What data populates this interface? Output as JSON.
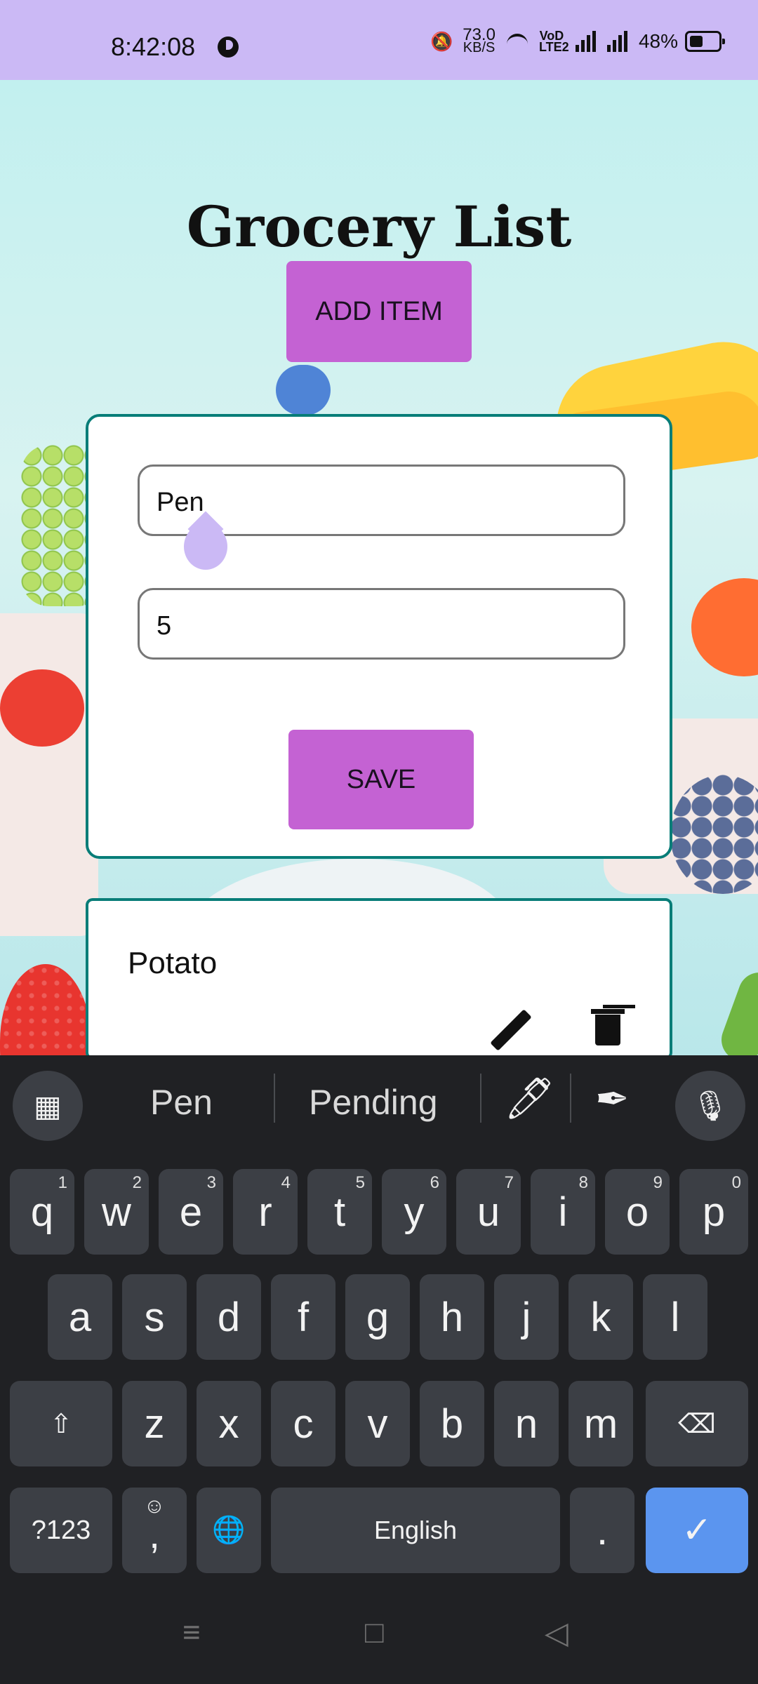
{
  "status": {
    "time": "8:42:08",
    "network_speed": "73.0",
    "network_unit": "KB/S",
    "network_type": "VoD LTE2",
    "battery": "48%"
  },
  "app": {
    "title": "Grocery List",
    "add_button": "ADD ITEM",
    "form": {
      "name_value": "Pen",
      "quantity_value": "5",
      "save_button": "SAVE"
    },
    "items": [
      {
        "name": "Potato"
      }
    ]
  },
  "keyboard": {
    "suggestions": [
      "Pen",
      "Pending"
    ],
    "row1": [
      {
        "key": "q",
        "hint": "1"
      },
      {
        "key": "w",
        "hint": "2"
      },
      {
        "key": "e",
        "hint": "3"
      },
      {
        "key": "r",
        "hint": "4"
      },
      {
        "key": "t",
        "hint": "5"
      },
      {
        "key": "y",
        "hint": "6"
      },
      {
        "key": "u",
        "hint": "7"
      },
      {
        "key": "i",
        "hint": "8"
      },
      {
        "key": "o",
        "hint": "9"
      },
      {
        "key": "p",
        "hint": "0"
      }
    ],
    "row2": [
      "a",
      "s",
      "d",
      "f",
      "g",
      "h",
      "j",
      "k",
      "l"
    ],
    "row3": [
      "z",
      "x",
      "c",
      "v",
      "b",
      "n",
      "m"
    ],
    "symbols_key": "?123",
    "comma_key": ",",
    "space_label": "English",
    "period_key": "."
  },
  "icons": {
    "accent": "#c462d3",
    "card_border": "#087d78",
    "keyboard_enter": "#5b95ef"
  }
}
